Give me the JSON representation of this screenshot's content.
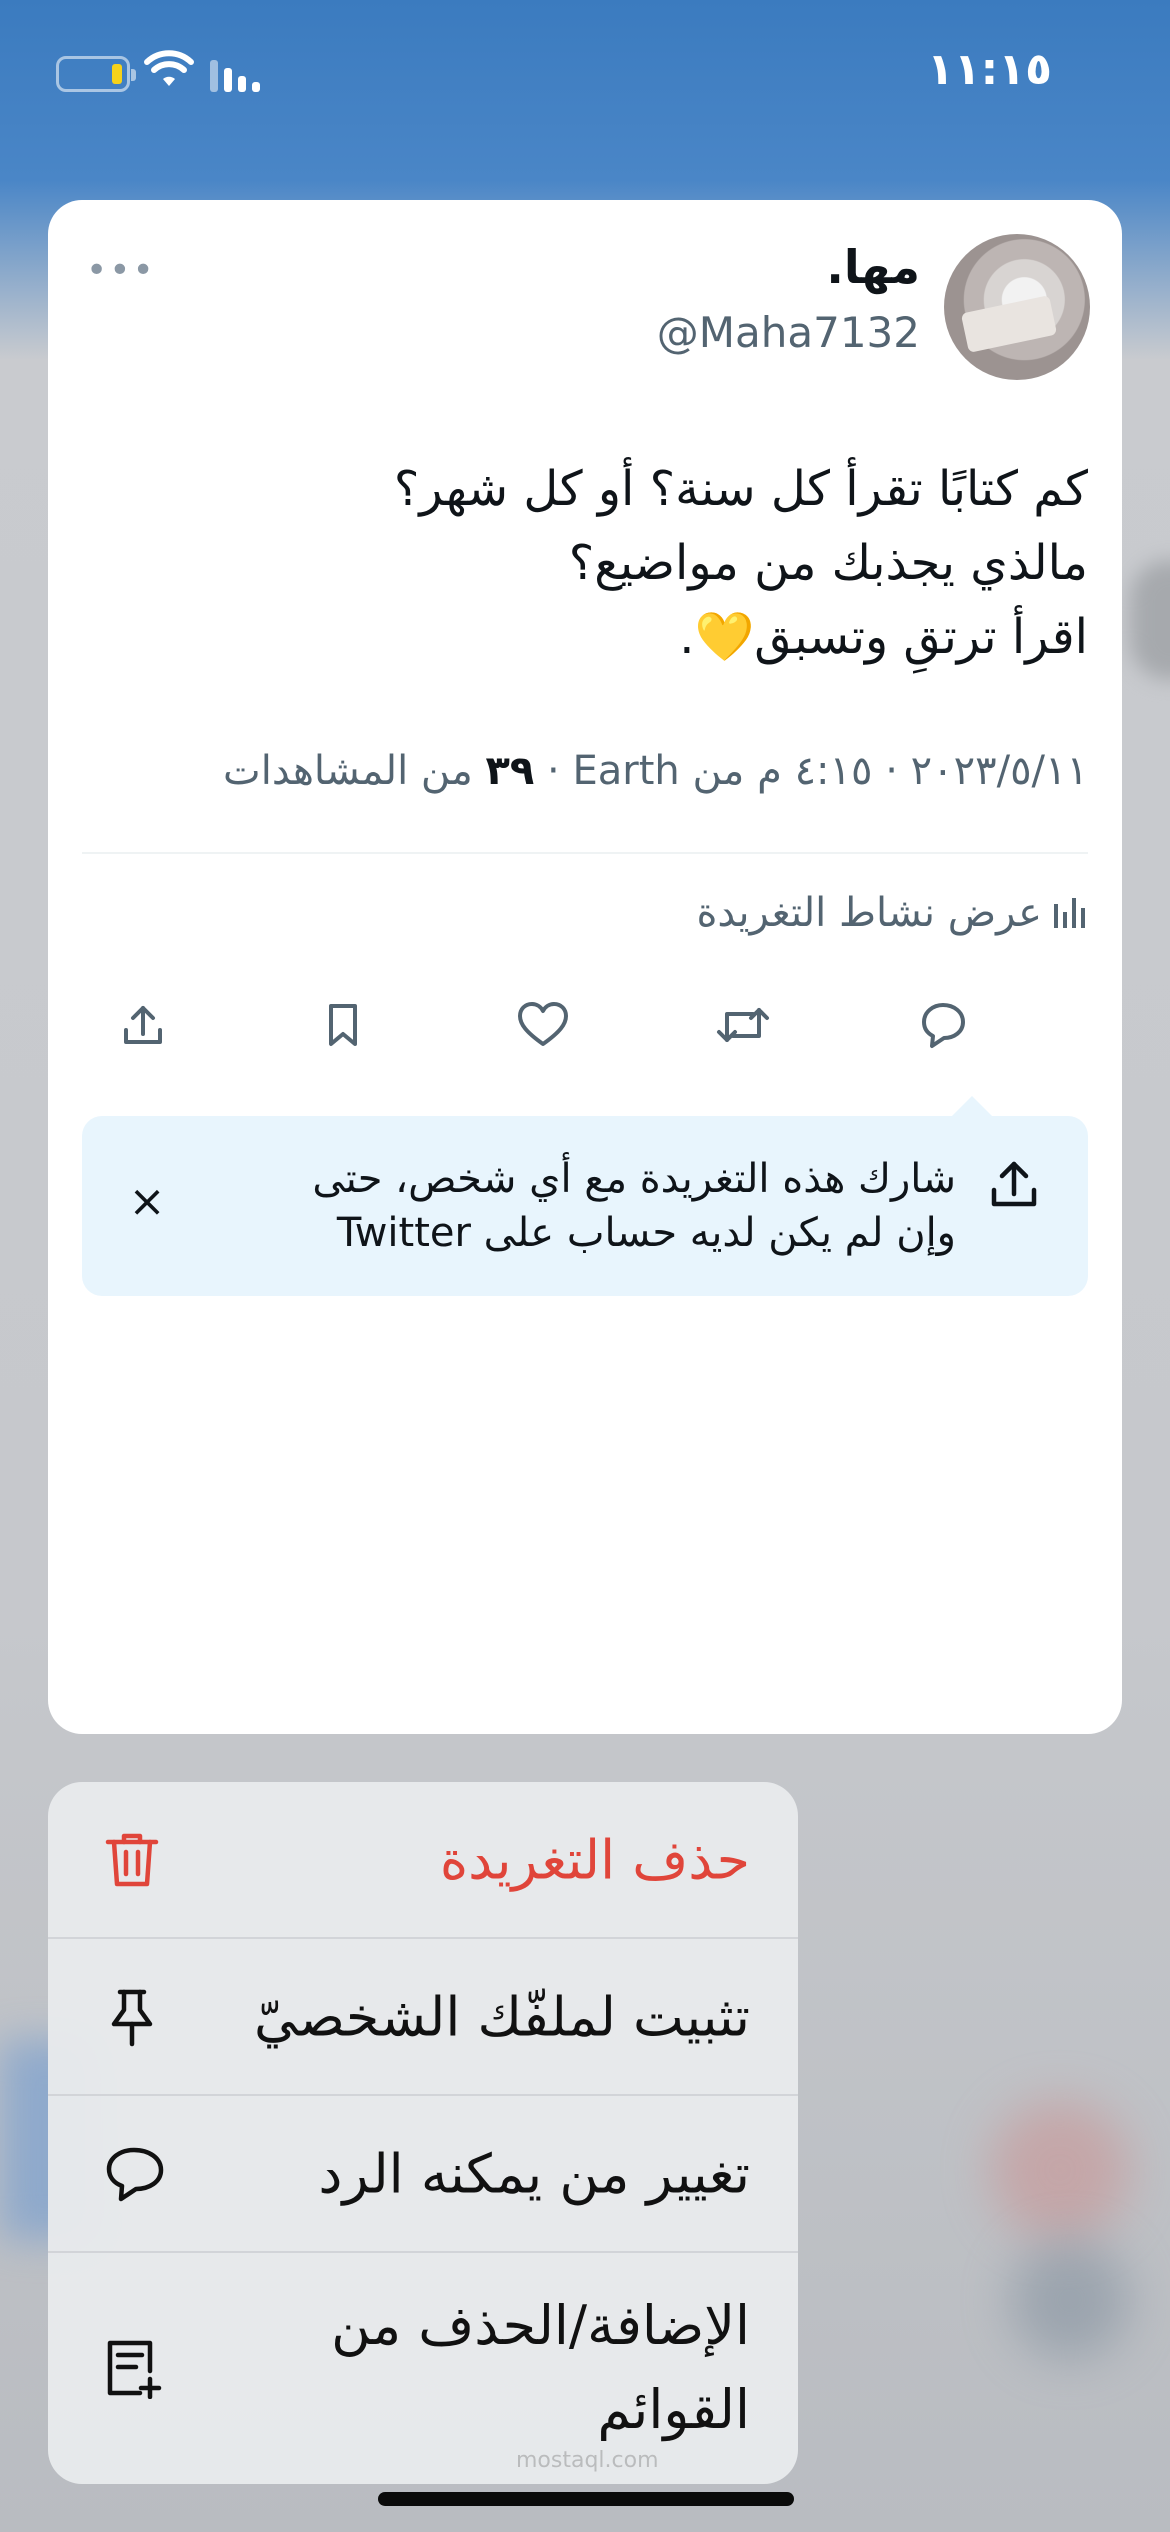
{
  "status_bar": {
    "time": "١١:١٥",
    "battery_color": "#f6d21a"
  },
  "tweet": {
    "author_name": "مها.",
    "handle": "@Maha7132",
    "text_lines": [
      "كم كتابًا تقرأ كل سنة؟ أو كل شهر؟",
      "مالذي يجذبك من مواضيع؟",
      "اقرأ ترتقِ وتسبق💛."
    ],
    "meta_date": "٢٠٢٣/٥/١١ · ٤:١٥ م من Earth · ",
    "views_count": "٣٩",
    "views_label": " من المشاهدات",
    "activity_label": "عرض نشاط التغريدة",
    "actions": [
      "reply-icon",
      "retweet-icon",
      "like-icon",
      "bookmark-icon",
      "share-icon"
    ]
  },
  "share_tip": {
    "line1": "شارك هذه التغريدة مع أي شخص، حتى",
    "line2": "وإن لم يكن لديه حساب على Twitter",
    "close": "×"
  },
  "menu": {
    "delete": "حذف التغريدة",
    "pin": "تثبيت لملفّك الشخصيّ",
    "reply_settings": "تغيير من يمكنه الرد",
    "lists": "الإضافة/الحذف من القوائم",
    "danger_color": "#e0453a"
  },
  "watermark": "mostaql.com"
}
